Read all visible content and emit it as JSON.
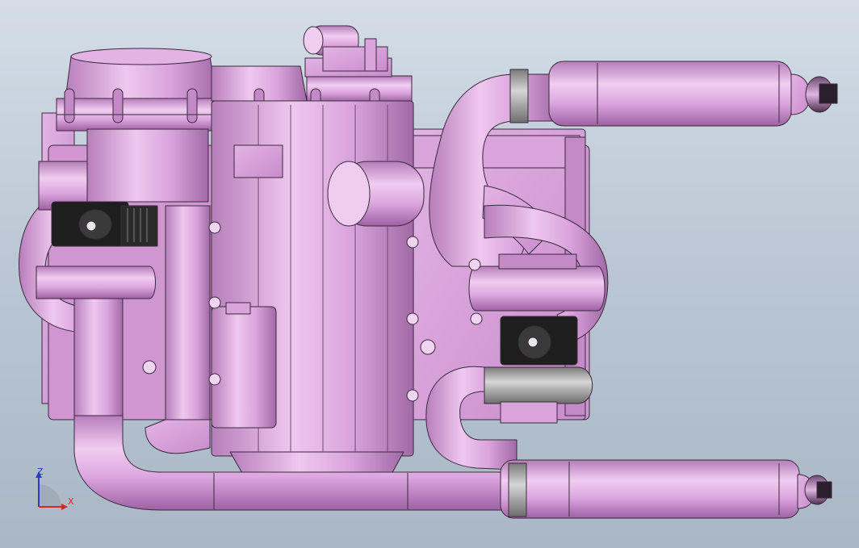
{
  "viewport": {
    "background_top": "#d4dde7",
    "background_bottom": "#a9b7c6"
  },
  "model": {
    "body_color": "#d79fd9",
    "body_light": "#efc9ef",
    "body_dark": "#a86aad",
    "edge_color": "#3a2a3c",
    "black_part_color": "#1e1e1e",
    "gray_part_color": "#8f8f8f"
  },
  "triad": {
    "z_label": "Z",
    "x_label": "X",
    "z_color": "#2a3cc8",
    "x_color": "#d62828"
  }
}
